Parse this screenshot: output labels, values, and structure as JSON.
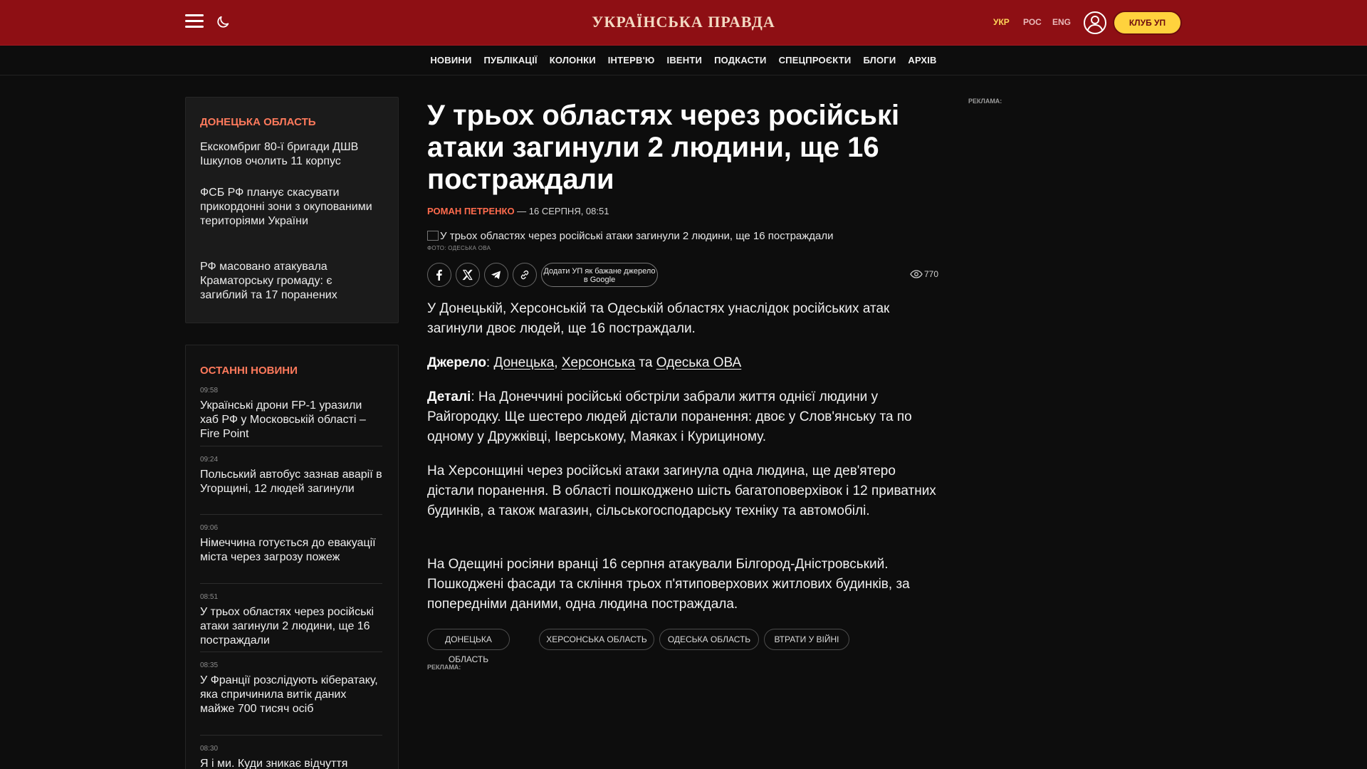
{
  "header": {
    "logo": "УКРАЇНСЬКА ПРАВДА",
    "languages": [
      "УКР",
      "РОС",
      "ENG"
    ],
    "active_language": "УКР",
    "club_button": "КЛУБ УП"
  },
  "nav": {
    "items": [
      "НОВИНИ",
      "ПУБЛІКАЦІЇ",
      "КОЛОНКИ",
      "ІНТЕРВ'Ю",
      "ІВЕНТИ",
      "ПОДКАСТИ",
      "СПЕЦПРОЄКТИ",
      "БЛОГИ",
      "АРХІВ"
    ]
  },
  "region_box": {
    "title": "ДОНЕЦЬКА ОБЛАСТЬ",
    "items": [
      "Екскомбриг 80-ї бригади ДШВ Ішкулов очолить 11 корпус",
      "ФСБ РФ планує скасувати прикордонні зони з окупованими територіями України",
      "РФ масовано атакувала Краматорську громаду: є загиблий та 17 поранених"
    ]
  },
  "latest": {
    "title": "ОСТАННІ НОВИНИ",
    "items": [
      {
        "time": "09:58",
        "title": "Українські дрони FP-1 уразили хаб РФ у Московській області – Fire Point"
      },
      {
        "time": "09:24",
        "title": "Польський автобус зазнав аварії в Угорщині, 12 людей загинули"
      },
      {
        "time": "09:06",
        "title": "Німеччина готується до евакуації міста через загрозу пожеж"
      },
      {
        "time": "08:51",
        "title": "У трьох областях через російські атаки загинули 2 людини, ще 16 постраждали"
      },
      {
        "time": "08:35",
        "title": "У Франції розслідують кібератаку, яка спричинила витік даних майже 700 тисяч осіб"
      },
      {
        "time": "08:30",
        "title": "Я і ми. Куди зникає відчуття"
      }
    ]
  },
  "article": {
    "headline": "У трьох областях через російські атаки загинули 2 людини, ще 16 постраждали",
    "author": "РОМАН ПЕТРЕНКО",
    "date": " — 16 СЕРПНЯ, 08:51",
    "photo_alt": "У трьох областях через російські атаки загинули 2 людини, ще 16 постраждали",
    "photo_credit": "ФОТО: ОДЕСЬКА ОВА",
    "google_button": "Додати УП як бажане джерело в Google",
    "views": "770",
    "lead": "У Донецькій, Херсонській та Одеській областях унаслідок російських атак загинули двоє людей, ще 16 постраждали.",
    "source_label": "Джерело",
    "source_colon": ": ",
    "source_link_1": "Донецька",
    "source_comma": ", ",
    "source_link_2": "Херсонська",
    "source_and": " та ",
    "source_link_3": "Одеська ОВА",
    "details_label": "Деталі",
    "details_text": ": На Донеччині російські обстріли забрали життя однієї людини у Райгородку. Ще шестеро людей дістали поранення: двоє у Слов'янську та по одному у Дружківці, Іверському, Маяках і Курициному.",
    "para_kherson": "На Херсонщині через російські атаки загинула одна людина, ще дев'ятеро дістали поранення. В області пошкоджено шість багатоповерхівок і 12 приватних будинків, а також магазин, сільськогосподарську техніку та автомобілі.",
    "para_odesa": "На Одещині росіяни вранці 16 серпня атакували Білгород-Дністровський. Пошкоджені фасади та скління трьох п'ятиповерхових житлових будинків, за попередніми даними, одна людина постраждала.",
    "tags": [
      "ДОНЕЦЬКА ОБЛАСТЬ",
      "ХЕРСОНСЬКА ОБЛАСТЬ",
      "ОДЕСЬКА ОБЛАСТЬ",
      "ВТРАТИ У ВІЙНІ"
    ]
  },
  "ads": {
    "label": "РЕКЛАМА:"
  },
  "colors": {
    "header_bg": "#8e0f14",
    "accent": "#ff6b4d",
    "club_button": "#ffd23d",
    "page_bg": "#0d0d0d"
  }
}
